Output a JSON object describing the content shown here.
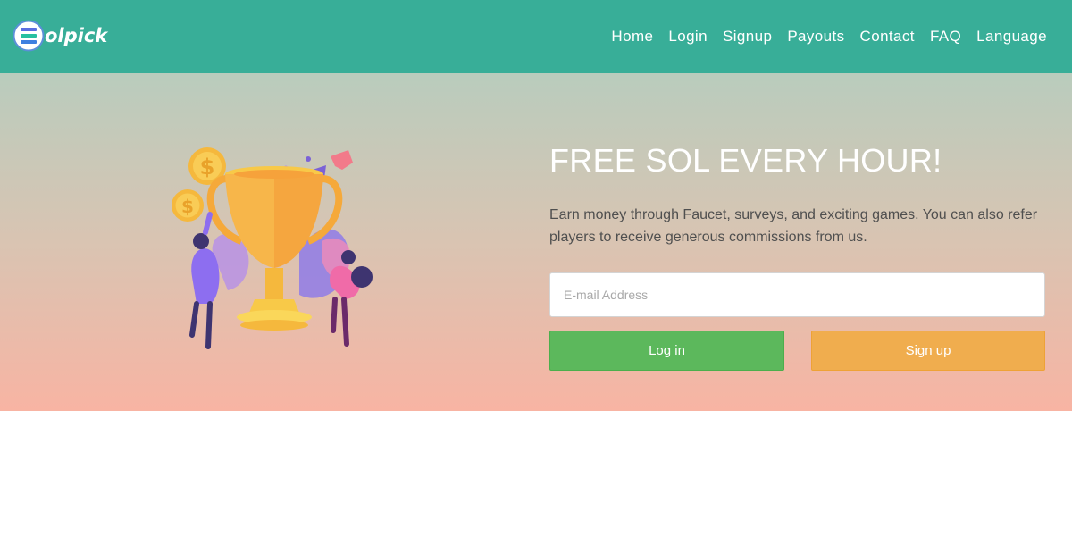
{
  "brand": {
    "name": "olpick",
    "logo_icon": "solana-s-logo-icon"
  },
  "nav": {
    "items": [
      {
        "label": "Home"
      },
      {
        "label": "Login"
      },
      {
        "label": "Signup"
      },
      {
        "label": "Payouts"
      },
      {
        "label": "Contact"
      },
      {
        "label": "FAQ"
      },
      {
        "label": "Language"
      }
    ]
  },
  "hero": {
    "headline": "FREE SOL EVERY HOUR!",
    "subtext": "Earn money through Faucet, surveys, and exciting games. You can also refer players to receive generous commissions from us.",
    "illustration": "trophy-celebration-illustration",
    "email_placeholder": "E-mail Address",
    "email_value": "",
    "login_label": "Log in",
    "signup_label": "Sign up"
  },
  "colors": {
    "navbar": "#38ae98",
    "hero_top": "#b9ccbd",
    "hero_bottom": "#f8b4a3",
    "login_button": "#5cb85c",
    "signup_button": "#f0ad4e"
  }
}
